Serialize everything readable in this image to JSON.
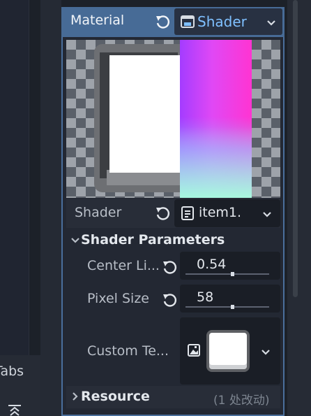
{
  "left_dock": {
    "tabs_label": "Tabs"
  },
  "material": {
    "header_title": "Material",
    "shader_type": {
      "label": "Shader",
      "icon": "shader-icon"
    },
    "shader_row": {
      "label": "Shader",
      "value": "item1."
    }
  },
  "shader_parameters": {
    "title": "Shader Parameters",
    "params": [
      {
        "label": "Center Li...",
        "value": "0.54",
        "slider_ratio": 0.54
      },
      {
        "label": "Pixel Size",
        "value": "58",
        "slider_ratio": 0.58
      },
      {
        "label": "Custom Te...",
        "value": ""
      }
    ]
  },
  "resource": {
    "title": "Resource",
    "note": "(1 处改动)"
  },
  "colors": {
    "header": "#476b96",
    "accent": "#7fc0ff",
    "panel_border": "#4a6f9c"
  }
}
